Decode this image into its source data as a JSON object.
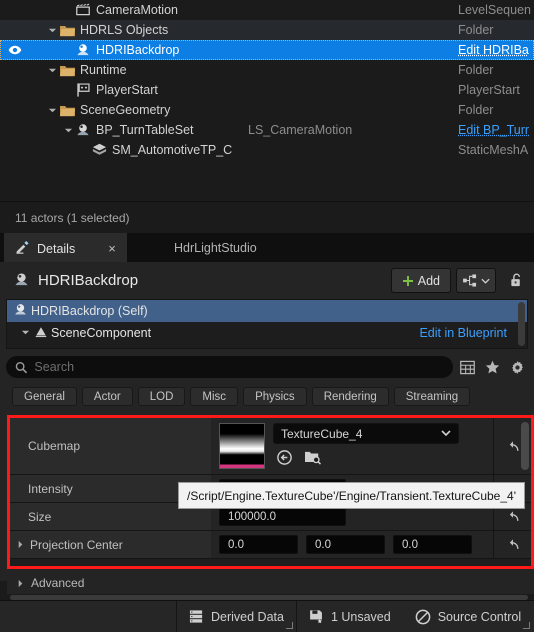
{
  "outliner": {
    "rows": [
      {
        "label": "CameraMotion",
        "type": "LevelSequen",
        "icon": "clapperboard-icon",
        "indent": 62,
        "twisty": "none",
        "state": "normal",
        "mid": ""
      },
      {
        "label": "HDRLS Objects",
        "type": "Folder",
        "icon": "folder-icon",
        "indent": 46,
        "twisty": "open",
        "state": "alt",
        "mid": ""
      },
      {
        "label": "HDRIBackdrop",
        "type": "Edit HDRIBa",
        "icon": "hdri-sphere-icon",
        "indent": 62,
        "twisty": "none",
        "state": "selected",
        "mid": "",
        "eye": true,
        "typeLink": true
      },
      {
        "label": "Runtime",
        "type": "Folder",
        "icon": "folder-icon",
        "indent": 46,
        "twisty": "open",
        "state": "normal",
        "mid": ""
      },
      {
        "label": "PlayerStart",
        "type": "PlayerStart",
        "icon": "playerstart-flag-icon",
        "indent": 62,
        "twisty": "none",
        "state": "normal",
        "mid": ""
      },
      {
        "label": "SceneGeometry",
        "type": "Folder",
        "icon": "folder-icon",
        "indent": 46,
        "twisty": "open",
        "state": "normal",
        "mid": ""
      },
      {
        "label": "BP_TurnTableSet",
        "type": "Edit BP_Turr",
        "icon": "hdri-sphere-icon",
        "indent": 62,
        "twisty": "open",
        "state": "normal",
        "mid": "LS_CameraMotion",
        "typeLink": true
      },
      {
        "label": "SM_AutomotiveTP_C",
        "type": "StaticMeshA",
        "icon": "static-mesh-icon",
        "indent": 78,
        "twisty": "none",
        "state": "normal",
        "mid": ""
      }
    ],
    "status": "11 actors (1 selected)"
  },
  "tabs": {
    "active": "Details",
    "close_label": "×",
    "inactive": "HdrLightStudio"
  },
  "details": {
    "title": "HDRIBackdrop",
    "add_label": "Add",
    "component_tree": {
      "self_label": "HDRIBackdrop (Self)",
      "child_label": "SceneComponent",
      "edit_link": "Edit in Blueprint"
    },
    "search": {
      "placeholder": "Search",
      "value": ""
    },
    "chips": [
      "General",
      "Actor",
      "LOD",
      "Misc",
      "Physics",
      "Rendering",
      "Streaming"
    ],
    "chip_active": "All",
    "properties": [
      {
        "name": "Cubemap",
        "kind": "asset",
        "value": "TextureCube_4"
      },
      {
        "name": "Intensity",
        "kind": "number",
        "value": ""
      },
      {
        "name": "Size",
        "kind": "number",
        "value": "100000.0"
      },
      {
        "name": "Projection Center",
        "kind": "vector",
        "values": [
          "0.0",
          "0.0",
          "0.0"
        ],
        "expandable": true
      }
    ],
    "advanced_label": "Advanced"
  },
  "tooltip": {
    "text": "/Script/Engine.TextureCube'/Engine/Transient.TextureCube_4'"
  },
  "statusbar": {
    "derived_data": "Derived Data",
    "unsaved": "1 Unsaved",
    "source_control": "Source Control"
  },
  "colors": {
    "selection_blue": "#0d7ee3",
    "link_blue": "#3aa0ff",
    "highlight_red": "#ff1a1a",
    "folder_amber": "#c79a4e",
    "accent_green": "#7dc242"
  }
}
